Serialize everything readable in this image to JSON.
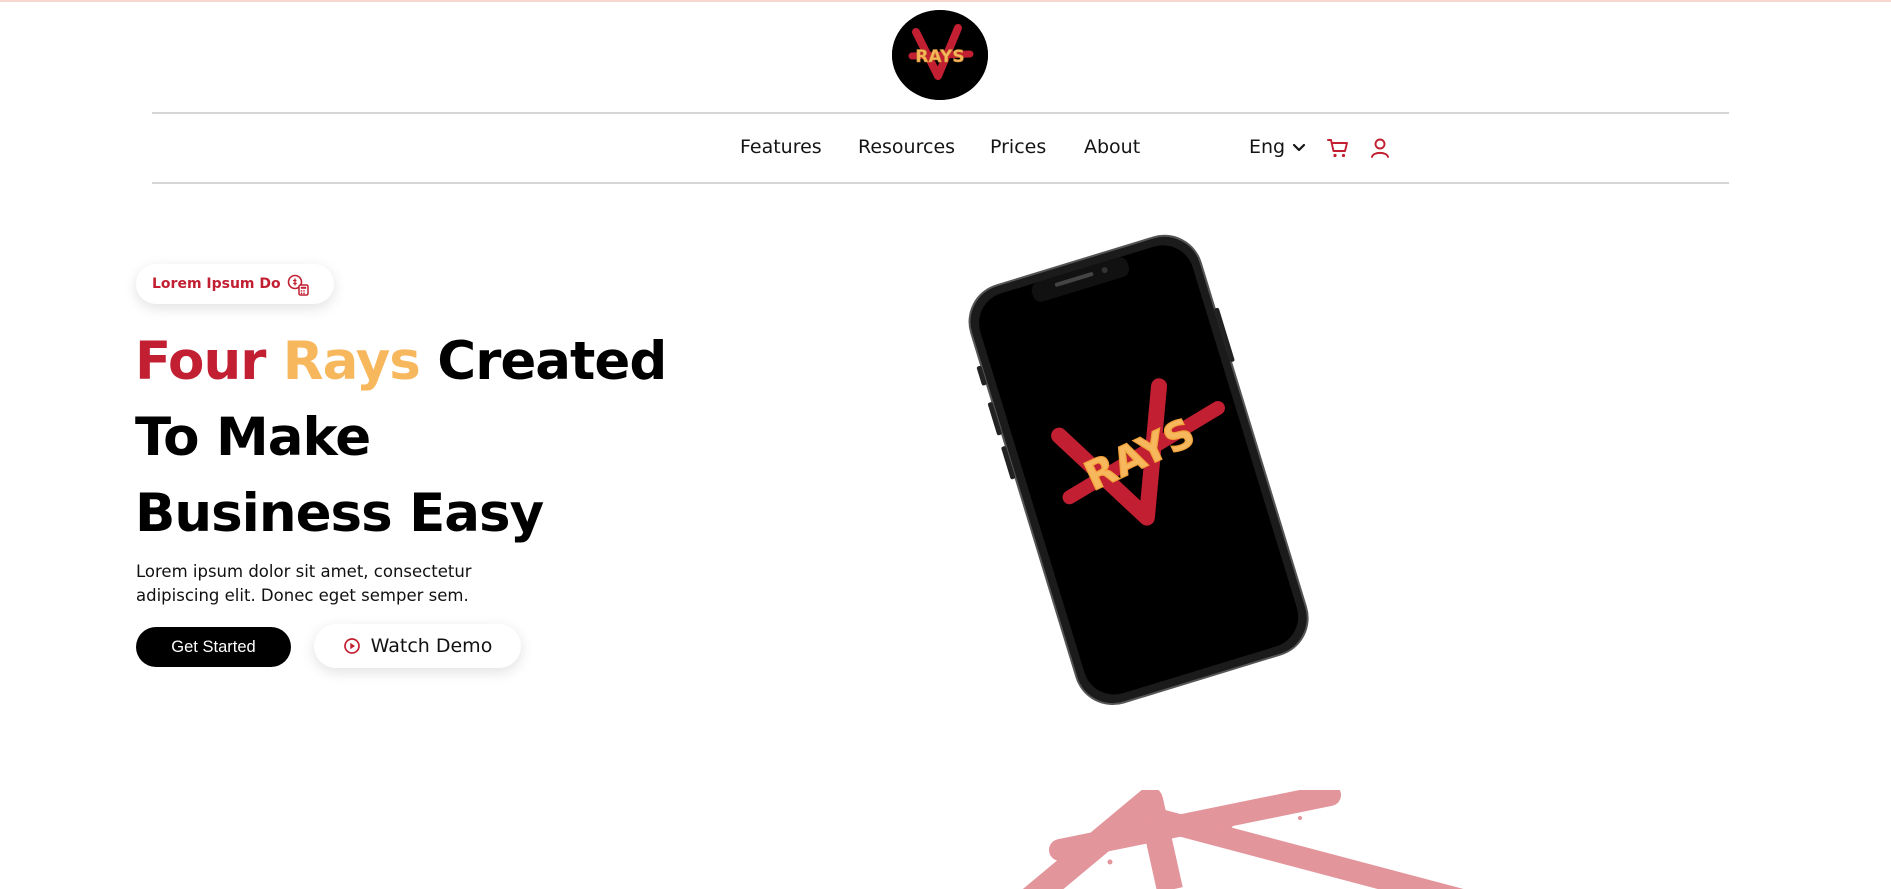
{
  "brand": {
    "logo_text": "RAYS",
    "colors": {
      "red": "#c21f32",
      "gold": "#f7b75c",
      "black": "#000000"
    }
  },
  "nav": {
    "items": [
      {
        "label": "Features"
      },
      {
        "label": "Resources"
      },
      {
        "label": "Prices"
      },
      {
        "label": "About"
      }
    ],
    "language": "Eng",
    "icons": [
      "chevron-down-icon",
      "cart-icon",
      "user-icon"
    ]
  },
  "hero": {
    "badge": {
      "label": "Lorem Ipsum Do",
      "icon": "coin-calculator-icon"
    },
    "headline": {
      "word_red": "Four",
      "word_gold": "Rays",
      "word_rest": "Created",
      "line2": "To Make",
      "line3": "Business Easy"
    },
    "description": "Lorem ipsum dolor sit amet, consectetur adipiscing elit. Donec eget semper sem.",
    "cta_primary": "Get Started",
    "cta_secondary": "Watch Demo",
    "phone_screen_text": "RAYS"
  }
}
